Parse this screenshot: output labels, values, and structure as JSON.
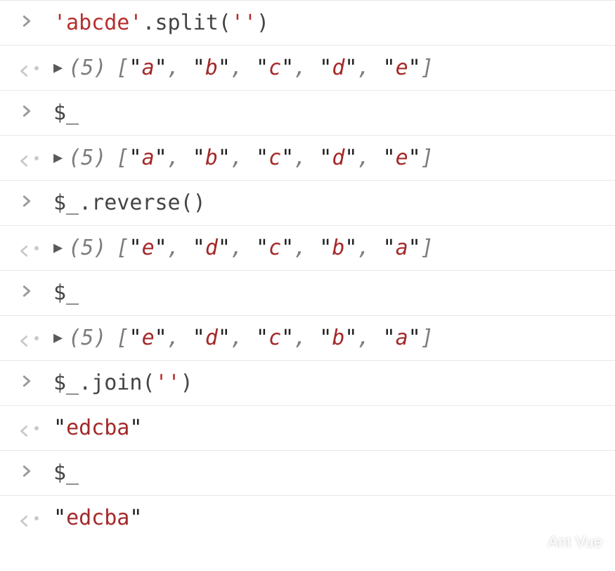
{
  "entries": [
    {
      "kind": "input",
      "tokens": [
        {
          "t": "'abcde'",
          "c": "kw-str"
        },
        {
          "t": ".split("
        },
        {
          "t": "''",
          "c": "kw-str"
        },
        {
          "t": ")"
        }
      ]
    },
    {
      "kind": "output-array",
      "length": "(5)",
      "items": [
        "a",
        "b",
        "c",
        "d",
        "e"
      ]
    },
    {
      "kind": "input",
      "tokens": [
        {
          "t": "$_"
        }
      ]
    },
    {
      "kind": "output-array",
      "length": "(5)",
      "items": [
        "a",
        "b",
        "c",
        "d",
        "e"
      ]
    },
    {
      "kind": "input",
      "tokens": [
        {
          "t": "$_.reverse()"
        }
      ]
    },
    {
      "kind": "output-array",
      "length": "(5)",
      "items": [
        "e",
        "d",
        "c",
        "b",
        "a"
      ]
    },
    {
      "kind": "input",
      "tokens": [
        {
          "t": "$_"
        }
      ]
    },
    {
      "kind": "output-array",
      "length": "(5)",
      "items": [
        "e",
        "d",
        "c",
        "b",
        "a"
      ]
    },
    {
      "kind": "input",
      "tokens": [
        {
          "t": "$_.join("
        },
        {
          "t": "''",
          "c": "kw-str"
        },
        {
          "t": ")"
        }
      ]
    },
    {
      "kind": "output-string",
      "value": "edcba"
    },
    {
      "kind": "input",
      "tokens": [
        {
          "t": "$_"
        }
      ]
    },
    {
      "kind": "output-string",
      "value": "edcba"
    }
  ],
  "watermark": "Ant Vue"
}
